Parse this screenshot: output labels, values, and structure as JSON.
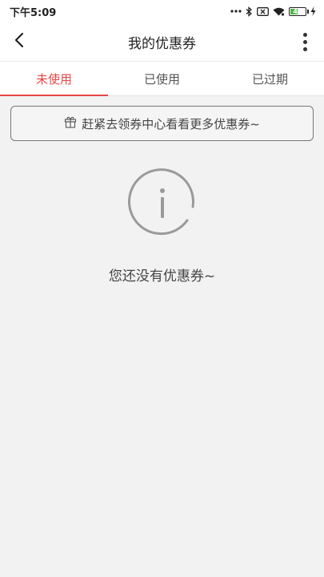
{
  "status_bar": {
    "time": "下午5:09",
    "battery_level": "47"
  },
  "header": {
    "title": "我的优惠券"
  },
  "tabs": [
    {
      "label": "未使用",
      "active": true
    },
    {
      "label": "已使用",
      "active": false
    },
    {
      "label": "已过期",
      "active": false
    }
  ],
  "promo": {
    "label": "赶紧去领券中心看看更多优惠券~"
  },
  "empty_state": {
    "message": "您还没有优惠券~"
  },
  "colors": {
    "accent": "#e84545",
    "background": "#f2f2f2"
  }
}
